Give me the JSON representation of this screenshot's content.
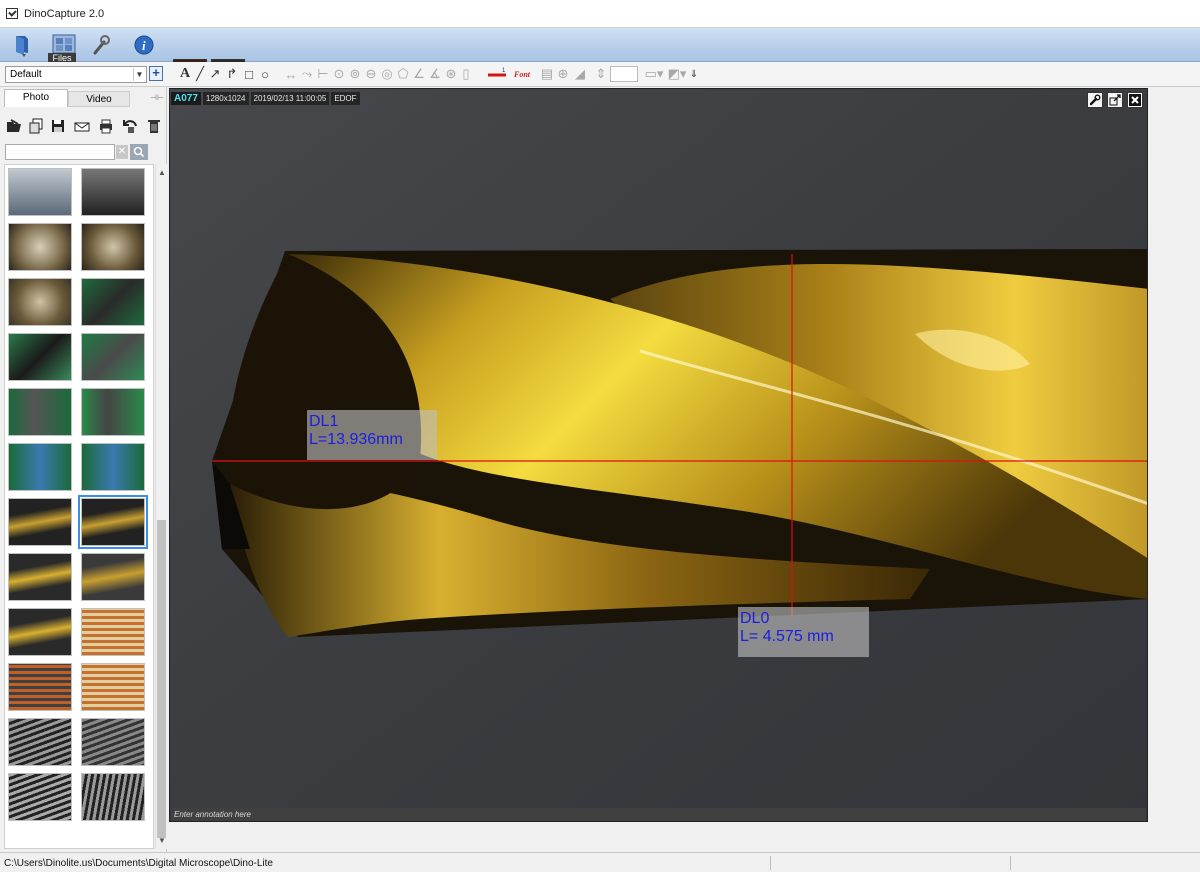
{
  "app": {
    "title": "DinoCapture 2.0"
  },
  "toolbar": {
    "files_label": "Files",
    "live_tab_number": "1"
  },
  "annotation_toolbar": {
    "profile_value": "Default",
    "font_label": "Font"
  },
  "left_panel": {
    "tabs": [
      "Photo",
      "Video"
    ],
    "search_placeholder": "",
    "gallery_count": 24,
    "selected_index": 13
  },
  "viewer": {
    "camera": "A077",
    "resolution": "1280x1024",
    "timestamp": "2019/02/13 11:00:05",
    "mode": "EDOF",
    "annotation_placeholder": "Enter annotation here",
    "measurements": [
      {
        "name": "DL1",
        "value": "L=13.936mm"
      },
      {
        "name": "DL0",
        "value": "L= 4.575 mm"
      }
    ]
  },
  "colors": {
    "measure_line": "#e01010",
    "measure_text": "#1a1ee0",
    "toolbar_top": "#cfe0f3",
    "toolbar_bottom": "#a8c3e4",
    "selection": "#3a8ee6"
  },
  "status": {
    "path": "C:\\Users\\Dinolite.us\\Documents\\Digital Microscope\\Dino-Lite"
  }
}
